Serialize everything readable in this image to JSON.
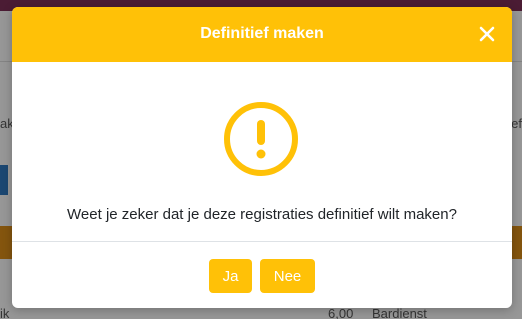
{
  "dialog": {
    "title": "Definitief maken",
    "message": "Weet je zeker dat je deze registraties definitief wilt maken?",
    "yes_label": "Ja",
    "no_label": "Nee",
    "icon": "exclamation-circle-icon",
    "close_icon": "close-icon",
    "accent_color": "#ffc107"
  },
  "background": {
    "left_fragment": "ak",
    "right_fragment": "ef",
    "bottom_left_fragment": "ik",
    "bottom_number": "6,00",
    "bottom_role": "Bardienst"
  }
}
